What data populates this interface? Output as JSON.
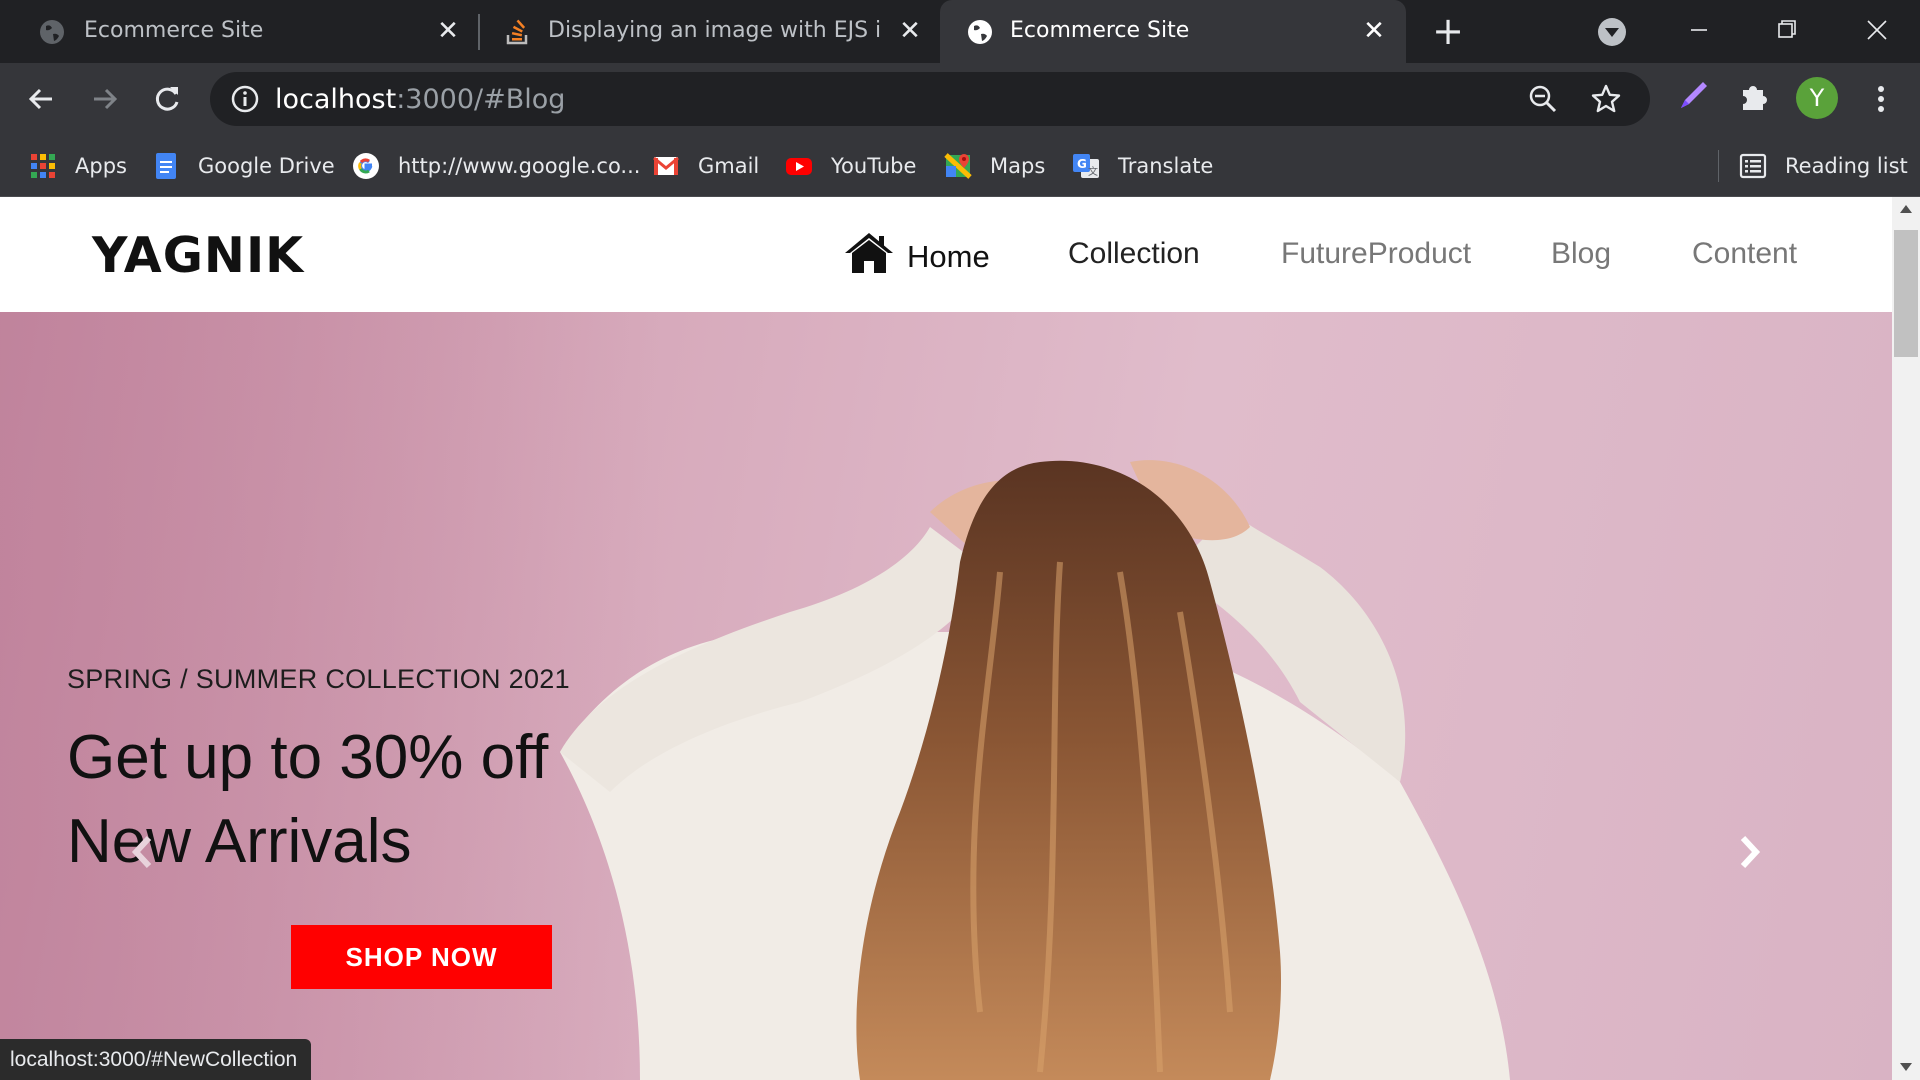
{
  "browser": {
    "tabs": [
      {
        "title": "Ecommerce Site",
        "icon": "globe-icon",
        "active": false
      },
      {
        "title": "Displaying an image with EJS in nod",
        "icon": "stackoverflow-icon",
        "active": false
      },
      {
        "title": "Ecommerce Site",
        "icon": "globe-icon",
        "active": true
      }
    ],
    "address": {
      "host": "localhost",
      "path": ":3000/#Blog"
    },
    "profile_initial": "Y",
    "bookmarks": [
      {
        "label": "Apps",
        "icon": "apps-grid-icon"
      },
      {
        "label": "Google Drive",
        "icon": "google-docs-icon"
      },
      {
        "label": "http://www.google.co...",
        "icon": "google-icon"
      },
      {
        "label": "Gmail",
        "icon": "gmail-icon"
      },
      {
        "label": "YouTube",
        "icon": "youtube-icon"
      },
      {
        "label": "Maps",
        "icon": "maps-icon"
      },
      {
        "label": "Translate",
        "icon": "translate-icon"
      }
    ],
    "reading_list": "Reading list",
    "status_url": "localhost:3000/#NewCollection"
  },
  "site": {
    "logo": "YAGNIK",
    "nav": {
      "home": "Home",
      "collection": "Collection",
      "future_product": "FutureProduct",
      "blog": "Blog",
      "content": "Content"
    },
    "hero": {
      "kicker": "SPRING / SUMMER COLLECTION 2021",
      "headline_1": "Get up to 30% off",
      "headline_2": "New Arrivals",
      "cta": "SHOP NOW"
    }
  },
  "colors": {
    "cta": "#ff0000",
    "hero_background": "#d6a8ba",
    "chrome_dark": "#202124",
    "chrome_toolbar": "#35363a"
  }
}
